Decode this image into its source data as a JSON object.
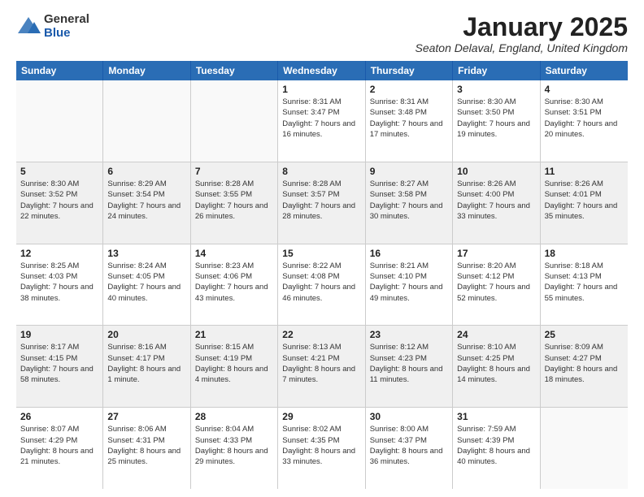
{
  "logo": {
    "general": "General",
    "blue": "Blue"
  },
  "title": "January 2025",
  "location": "Seaton Delaval, England, United Kingdom",
  "days_of_week": [
    "Sunday",
    "Monday",
    "Tuesday",
    "Wednesday",
    "Thursday",
    "Friday",
    "Saturday"
  ],
  "weeks": [
    [
      {
        "day": "",
        "content": ""
      },
      {
        "day": "",
        "content": ""
      },
      {
        "day": "",
        "content": ""
      },
      {
        "day": "1",
        "content": "Sunrise: 8:31 AM\nSunset: 3:47 PM\nDaylight: 7 hours\nand 16 minutes."
      },
      {
        "day": "2",
        "content": "Sunrise: 8:31 AM\nSunset: 3:48 PM\nDaylight: 7 hours\nand 17 minutes."
      },
      {
        "day": "3",
        "content": "Sunrise: 8:30 AM\nSunset: 3:50 PM\nDaylight: 7 hours\nand 19 minutes."
      },
      {
        "day": "4",
        "content": "Sunrise: 8:30 AM\nSunset: 3:51 PM\nDaylight: 7 hours\nand 20 minutes."
      }
    ],
    [
      {
        "day": "5",
        "content": "Sunrise: 8:30 AM\nSunset: 3:52 PM\nDaylight: 7 hours\nand 22 minutes."
      },
      {
        "day": "6",
        "content": "Sunrise: 8:29 AM\nSunset: 3:54 PM\nDaylight: 7 hours\nand 24 minutes."
      },
      {
        "day": "7",
        "content": "Sunrise: 8:28 AM\nSunset: 3:55 PM\nDaylight: 7 hours\nand 26 minutes."
      },
      {
        "day": "8",
        "content": "Sunrise: 8:28 AM\nSunset: 3:57 PM\nDaylight: 7 hours\nand 28 minutes."
      },
      {
        "day": "9",
        "content": "Sunrise: 8:27 AM\nSunset: 3:58 PM\nDaylight: 7 hours\nand 30 minutes."
      },
      {
        "day": "10",
        "content": "Sunrise: 8:26 AM\nSunset: 4:00 PM\nDaylight: 7 hours\nand 33 minutes."
      },
      {
        "day": "11",
        "content": "Sunrise: 8:26 AM\nSunset: 4:01 PM\nDaylight: 7 hours\nand 35 minutes."
      }
    ],
    [
      {
        "day": "12",
        "content": "Sunrise: 8:25 AM\nSunset: 4:03 PM\nDaylight: 7 hours\nand 38 minutes."
      },
      {
        "day": "13",
        "content": "Sunrise: 8:24 AM\nSunset: 4:05 PM\nDaylight: 7 hours\nand 40 minutes."
      },
      {
        "day": "14",
        "content": "Sunrise: 8:23 AM\nSunset: 4:06 PM\nDaylight: 7 hours\nand 43 minutes."
      },
      {
        "day": "15",
        "content": "Sunrise: 8:22 AM\nSunset: 4:08 PM\nDaylight: 7 hours\nand 46 minutes."
      },
      {
        "day": "16",
        "content": "Sunrise: 8:21 AM\nSunset: 4:10 PM\nDaylight: 7 hours\nand 49 minutes."
      },
      {
        "day": "17",
        "content": "Sunrise: 8:20 AM\nSunset: 4:12 PM\nDaylight: 7 hours\nand 52 minutes."
      },
      {
        "day": "18",
        "content": "Sunrise: 8:18 AM\nSunset: 4:13 PM\nDaylight: 7 hours\nand 55 minutes."
      }
    ],
    [
      {
        "day": "19",
        "content": "Sunrise: 8:17 AM\nSunset: 4:15 PM\nDaylight: 7 hours\nand 58 minutes."
      },
      {
        "day": "20",
        "content": "Sunrise: 8:16 AM\nSunset: 4:17 PM\nDaylight: 8 hours\nand 1 minute."
      },
      {
        "day": "21",
        "content": "Sunrise: 8:15 AM\nSunset: 4:19 PM\nDaylight: 8 hours\nand 4 minutes."
      },
      {
        "day": "22",
        "content": "Sunrise: 8:13 AM\nSunset: 4:21 PM\nDaylight: 8 hours\nand 7 minutes."
      },
      {
        "day": "23",
        "content": "Sunrise: 8:12 AM\nSunset: 4:23 PM\nDaylight: 8 hours\nand 11 minutes."
      },
      {
        "day": "24",
        "content": "Sunrise: 8:10 AM\nSunset: 4:25 PM\nDaylight: 8 hours\nand 14 minutes."
      },
      {
        "day": "25",
        "content": "Sunrise: 8:09 AM\nSunset: 4:27 PM\nDaylight: 8 hours\nand 18 minutes."
      }
    ],
    [
      {
        "day": "26",
        "content": "Sunrise: 8:07 AM\nSunset: 4:29 PM\nDaylight: 8 hours\nand 21 minutes."
      },
      {
        "day": "27",
        "content": "Sunrise: 8:06 AM\nSunset: 4:31 PM\nDaylight: 8 hours\nand 25 minutes."
      },
      {
        "day": "28",
        "content": "Sunrise: 8:04 AM\nSunset: 4:33 PM\nDaylight: 8 hours\nand 29 minutes."
      },
      {
        "day": "29",
        "content": "Sunrise: 8:02 AM\nSunset: 4:35 PM\nDaylight: 8 hours\nand 33 minutes."
      },
      {
        "day": "30",
        "content": "Sunrise: 8:00 AM\nSunset: 4:37 PM\nDaylight: 8 hours\nand 36 minutes."
      },
      {
        "day": "31",
        "content": "Sunrise: 7:59 AM\nSunset: 4:39 PM\nDaylight: 8 hours\nand 40 minutes."
      },
      {
        "day": "",
        "content": ""
      }
    ]
  ]
}
